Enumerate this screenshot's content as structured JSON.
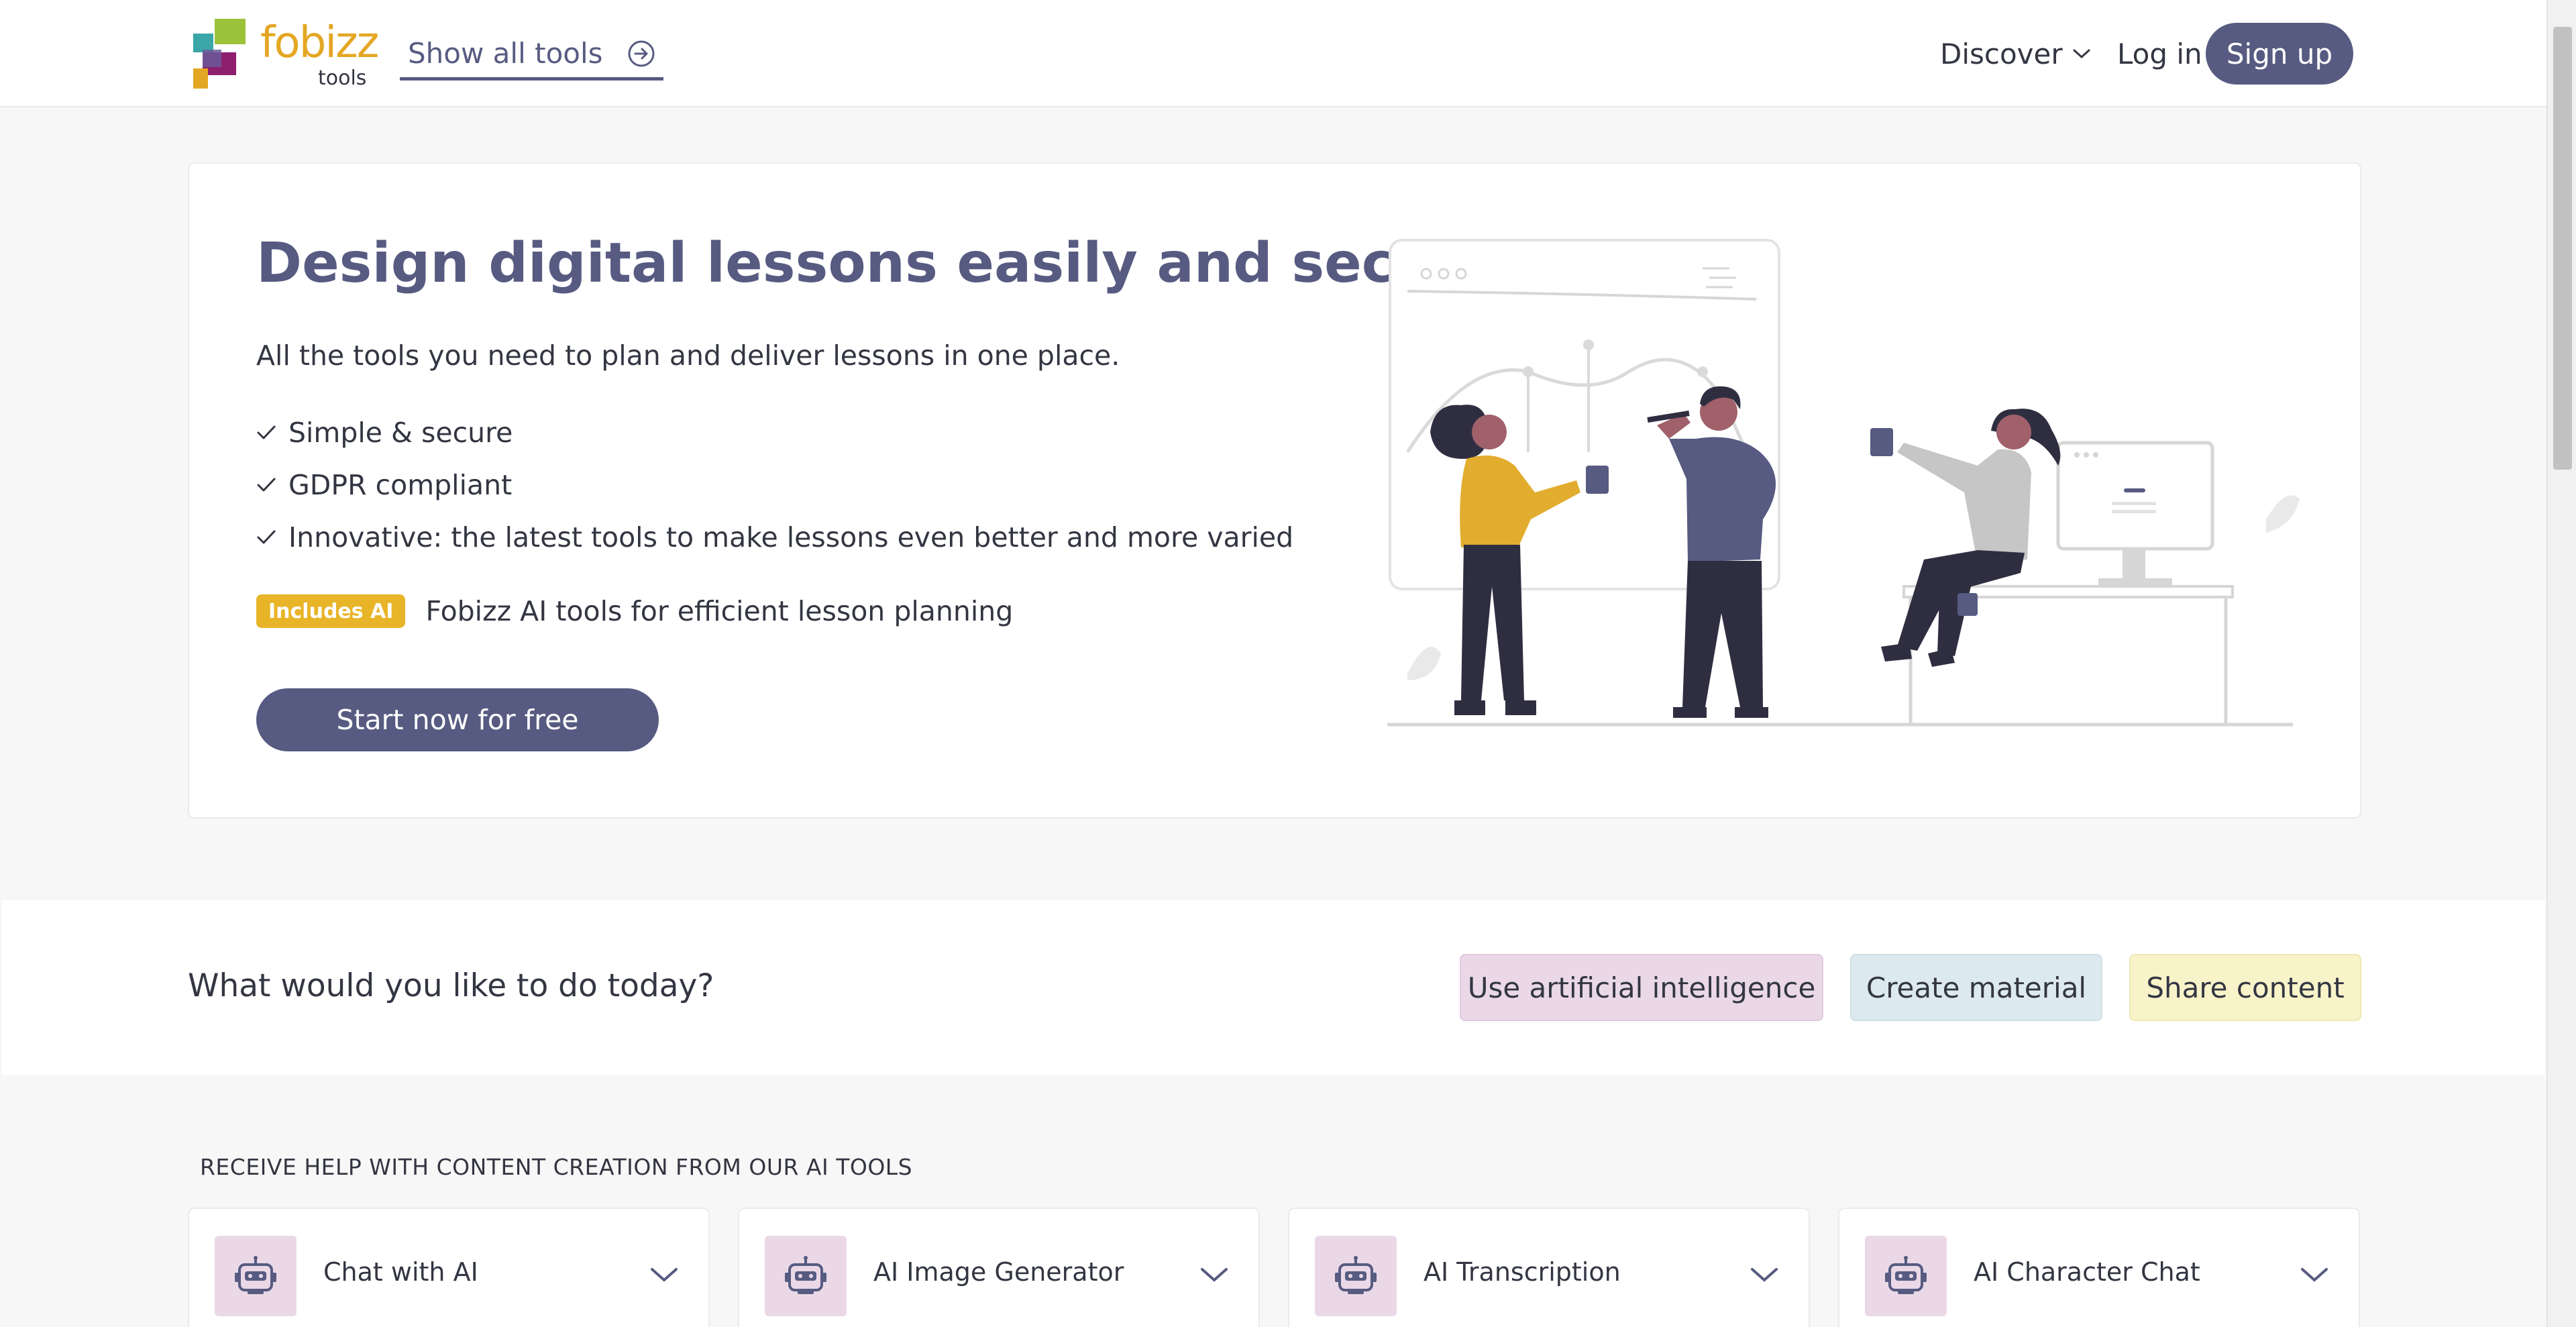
{
  "header": {
    "logo_text": "fobizz",
    "logo_sub": "tools",
    "show_all_label": "Show all tools",
    "discover_label": "Discover",
    "login_label": "Log in",
    "signup_label": "Sign up"
  },
  "hero": {
    "title": "Design digital lessons easily and securely",
    "subtitle": "All the tools you need to plan and deliver lessons in one place.",
    "features": [
      "Simple & secure",
      "GDPR compliant",
      "Innovative: the latest tools to make lessons even better and more varied"
    ],
    "ai_badge": "Includes AI",
    "ai_text": "Fobizz AI tools for efficient lesson planning",
    "cta_label": "Start now for free"
  },
  "today": {
    "question": "What would you like to do today?",
    "options": [
      "Use artificial intelligence",
      "Create material",
      "Share content"
    ]
  },
  "ai_tools": {
    "section_label": "RECEIVE HELP WITH CONTENT CREATION FROM OUR AI TOOLS",
    "tools": [
      {
        "name": "Chat with AI",
        "icon": "robot-icon"
      },
      {
        "name": "AI Image Generator",
        "icon": "robot-icon"
      },
      {
        "name": "AI Transcription",
        "icon": "robot-icon"
      },
      {
        "name": "AI Character Chat",
        "icon": "robot-icon"
      }
    ]
  },
  "colors": {
    "brand": "#575b81",
    "logo_accent": "#e4a723",
    "ai_badge": "#e8b428",
    "ai_pill": "#ead8e7",
    "create_pill": "#dce9ee",
    "share_pill": "#f8f3c9",
    "illustration_yellow": "#e2ad2e",
    "illustration_dark": "#2f2e41"
  }
}
